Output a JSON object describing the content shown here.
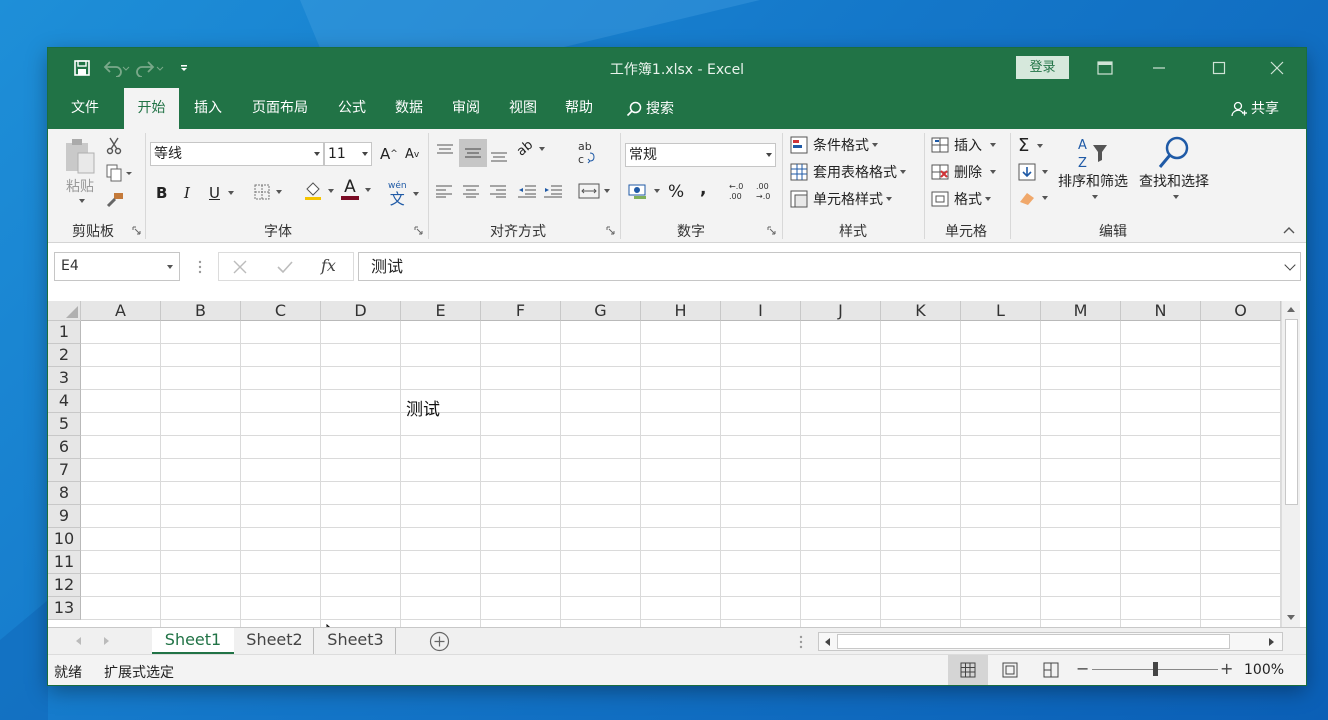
{
  "window": {
    "title": "工作簿1.xlsx  -  Excel",
    "login_label": "登录",
    "accent_color": "#217346"
  },
  "quick_access": {
    "icons": [
      "save-icon",
      "undo-icon",
      "redo-icon",
      "customize-icon"
    ]
  },
  "tabs": [
    {
      "label": "文件"
    },
    {
      "label": "开始"
    },
    {
      "label": "插入"
    },
    {
      "label": "页面布局"
    },
    {
      "label": "公式"
    },
    {
      "label": "数据"
    },
    {
      "label": "审阅"
    },
    {
      "label": "视图"
    },
    {
      "label": "帮助"
    }
  ],
  "search_label": "搜索",
  "share_label": "共享",
  "ribbon": {
    "clipboard": {
      "paste_label": "粘贴",
      "group_label": "剪贴板"
    },
    "font": {
      "family": "等线",
      "size": "11",
      "group_label": "字体",
      "bold": "B",
      "italic": "I",
      "underline": "U",
      "font_color_glyph": "A",
      "grow_glyph": "A",
      "shrink_glyph": "A",
      "phonetic_glyph": "wén"
    },
    "alignment": {
      "group_label": "对齐方式"
    },
    "number": {
      "format": "常规",
      "group_label": "数字",
      "percent": "%",
      "comma": ","
    },
    "styles": {
      "conditional": "条件格式",
      "table": "套用表格格式",
      "cell": "单元格样式",
      "group_label": "样式"
    },
    "cells": {
      "insert": "插入",
      "delete": "删除",
      "format": "格式",
      "group_label": "单元格"
    },
    "editing": {
      "sort_filter": "排序和筛选",
      "find_select": "查找和选择",
      "group_label": "编辑",
      "sum_glyph": "Σ"
    }
  },
  "formula_bar": {
    "name_box": "E4",
    "fx": "fx",
    "content": "测试"
  },
  "grid": {
    "columns": [
      "A",
      "B",
      "C",
      "D",
      "E",
      "F",
      "G",
      "H",
      "I",
      "J",
      "K",
      "L",
      "M",
      "N",
      "O"
    ],
    "rows": [
      "1",
      "2",
      "3",
      "4",
      "5",
      "6",
      "7",
      "8",
      "9",
      "10",
      "11",
      "12",
      "13"
    ],
    "cell_e4": "测试"
  },
  "sheets": [
    {
      "label": "Sheet1",
      "active": true
    },
    {
      "label": "Sheet2",
      "active": false
    },
    {
      "label": "Sheet3",
      "active": false
    }
  ],
  "status": {
    "ready": "就绪",
    "mode": "扩展式选定",
    "zoom": "100%",
    "zoom_level": 1.0
  }
}
